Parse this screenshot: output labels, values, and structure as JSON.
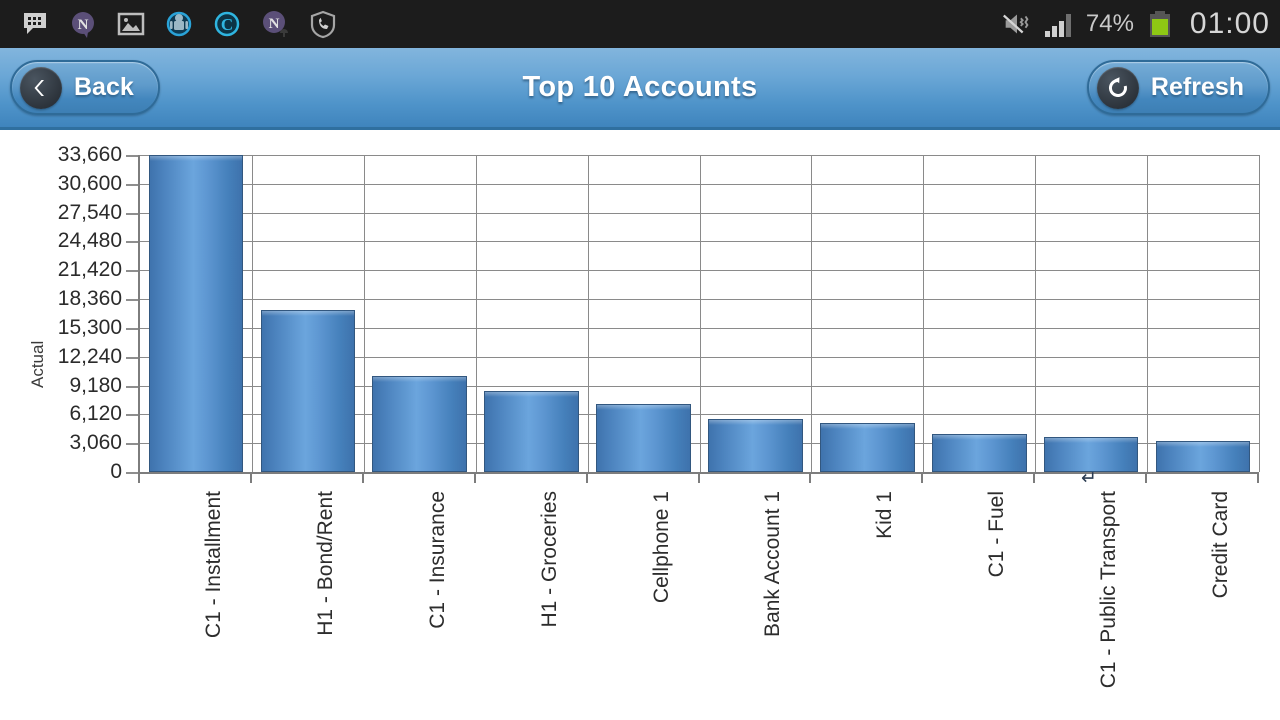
{
  "status_bar": {
    "icons": [
      {
        "name": "bbm-chat-icon",
        "glyph": "chat"
      },
      {
        "name": "nimbuzz-icon",
        "glyph": "N"
      },
      {
        "name": "gallery-image-icon",
        "glyph": "image"
      },
      {
        "name": "android-sync-icon",
        "glyph": "android"
      },
      {
        "name": "clean-master-icon",
        "glyph": "C"
      },
      {
        "name": "nimbuzz-notification-icon",
        "glyph": "N"
      },
      {
        "name": "call-shield-icon",
        "glyph": "shield"
      }
    ],
    "vibrate_mute_icon": "mute-vibrate-icon",
    "signal_icon": "signal-bars-icon",
    "battery_percent": "74%",
    "battery_icon": "battery-icon",
    "clock": "01:00"
  },
  "title_bar": {
    "back_label": "Back",
    "back_icon": "chevron-left-icon",
    "title": "Top 10 Accounts",
    "refresh_label": "Refresh",
    "refresh_icon": "refresh-circular-arrow-icon"
  },
  "colors": {
    "titlebar_top": "#82b5dd",
    "titlebar_bottom": "#3f84bd",
    "bar_fill_light": "#6ba5dd",
    "bar_fill_dark": "#3f73ad",
    "bar_stroke": "#32577f",
    "gridline": "#8a8a8a",
    "status_bg": "#1c1c1c",
    "battery_green": "#8ec814"
  },
  "chart_data": {
    "type": "bar",
    "title": "Top 10 Accounts",
    "xlabel": "",
    "ylabel": "Actual",
    "grid": true,
    "legend": "none",
    "ylim": [
      0,
      33660
    ],
    "yticks": [
      0,
      3060,
      6120,
      9180,
      12240,
      15300,
      18360,
      21420,
      24480,
      27540,
      30600,
      33660
    ],
    "ytick_labels": [
      "0",
      "3,060",
      "6,120",
      "9,180",
      "12,240",
      "15,300",
      "18,360",
      "21,420",
      "24,480",
      "27,540",
      "30,600",
      "33,660"
    ],
    "categories": [
      "C1 - Installment",
      "H1 - Bond/Rent",
      "C1 - Insurance",
      "H1 - Groceries",
      "Cellphone 1",
      "Bank Account 1",
      "Kid 1",
      "C1 - Fuel",
      "C1 - Public Transport",
      "Credit Card"
    ],
    "values": [
      33660,
      17200,
      10200,
      8600,
      7200,
      5630,
      5200,
      4035,
      3715,
      3290
    ]
  }
}
